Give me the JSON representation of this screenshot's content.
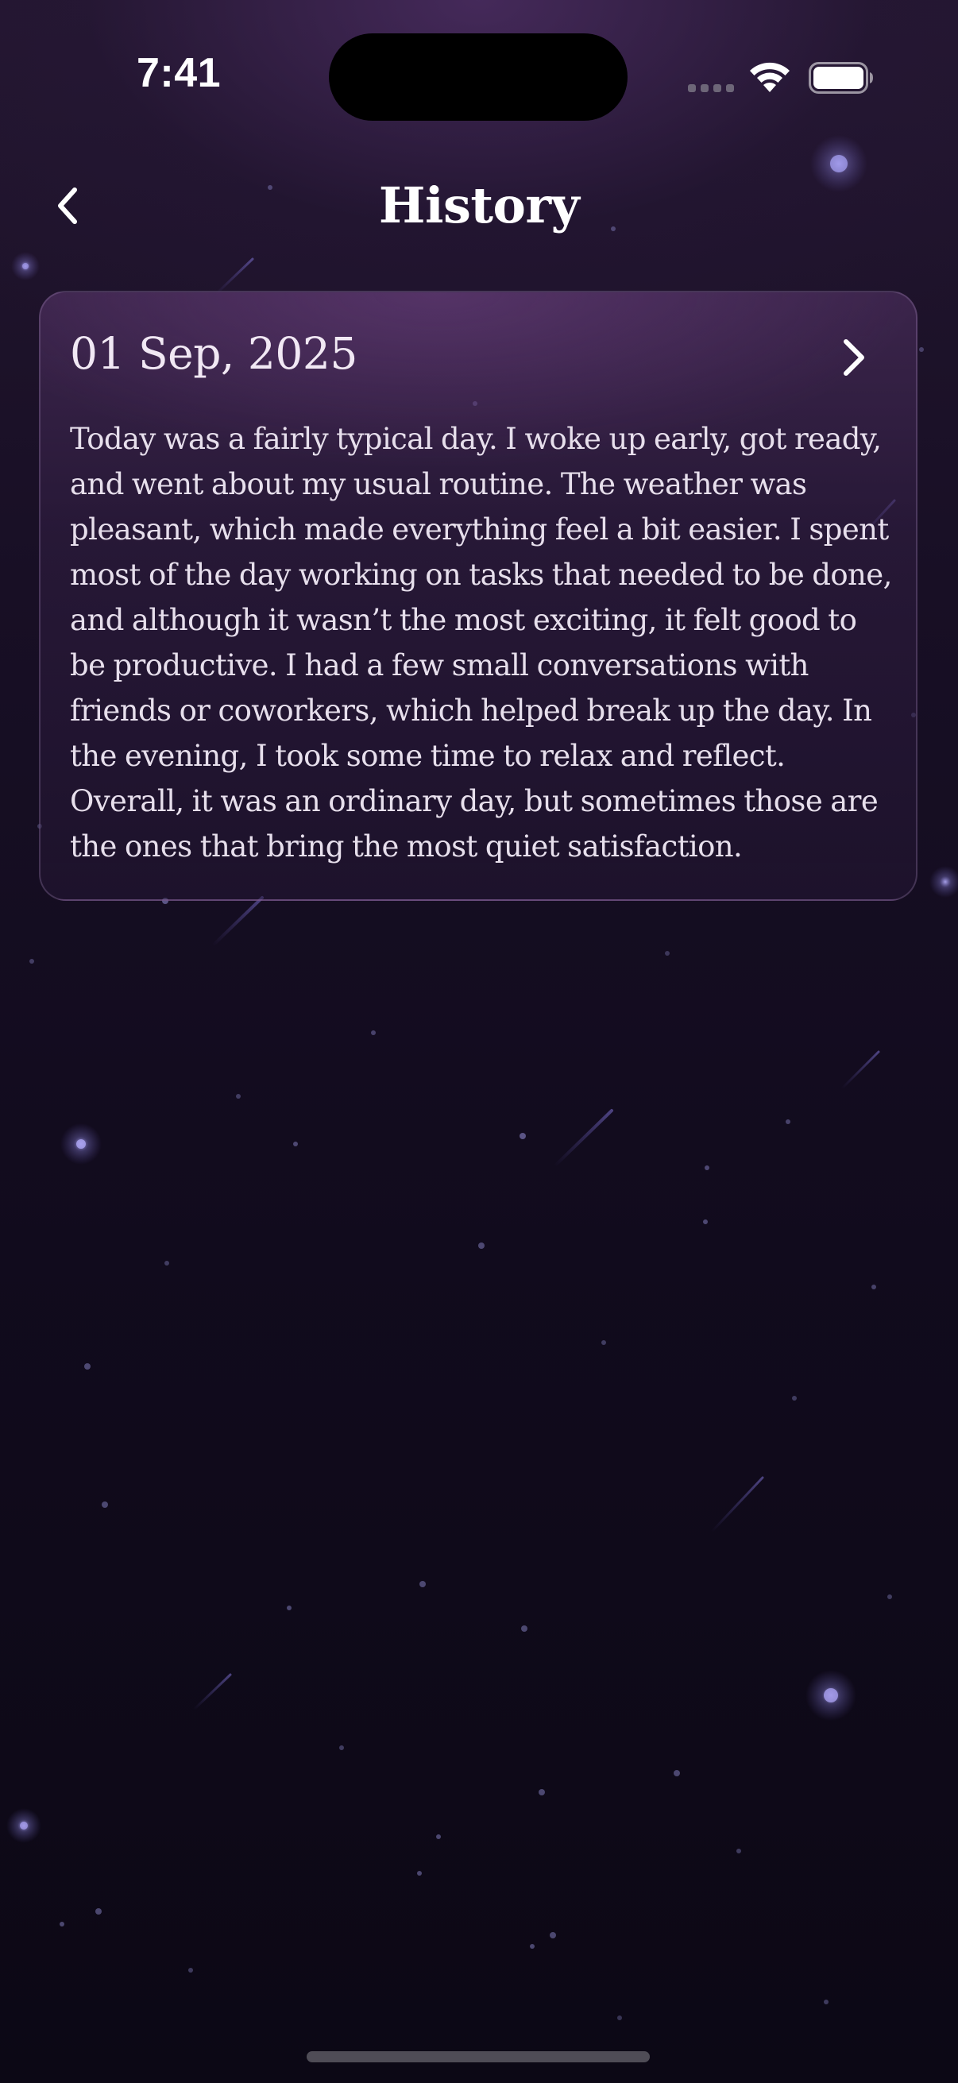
{
  "status_bar": {
    "time": "7:41"
  },
  "header": {
    "title": "History",
    "back_icon": "chevron-left-icon"
  },
  "entries": [
    {
      "date": "01 Sep, 2025",
      "text": "Today was a fairly typical day. I woke up early, got ready, and went about my usual routine. The weather was pleasant, which made everything feel a bit easier. I spent most of the day working on tasks that needed to be done, and although it wasn’t the most exciting, it felt good to be productive. I had a few small conversations with friends or coworkers, which helped break up the day. In the evening, I took some time to relax and reflect. Overall, it was an ordinary day, but sometimes those are the ones that bring the most quiet satisfaction.",
      "open_icon": "chevron-right-icon"
    }
  ],
  "colors": {
    "background_top": "#23162f",
    "background_bottom": "#0c0815",
    "card_border": "#7a5f8a",
    "text": "#f3ecf6"
  }
}
